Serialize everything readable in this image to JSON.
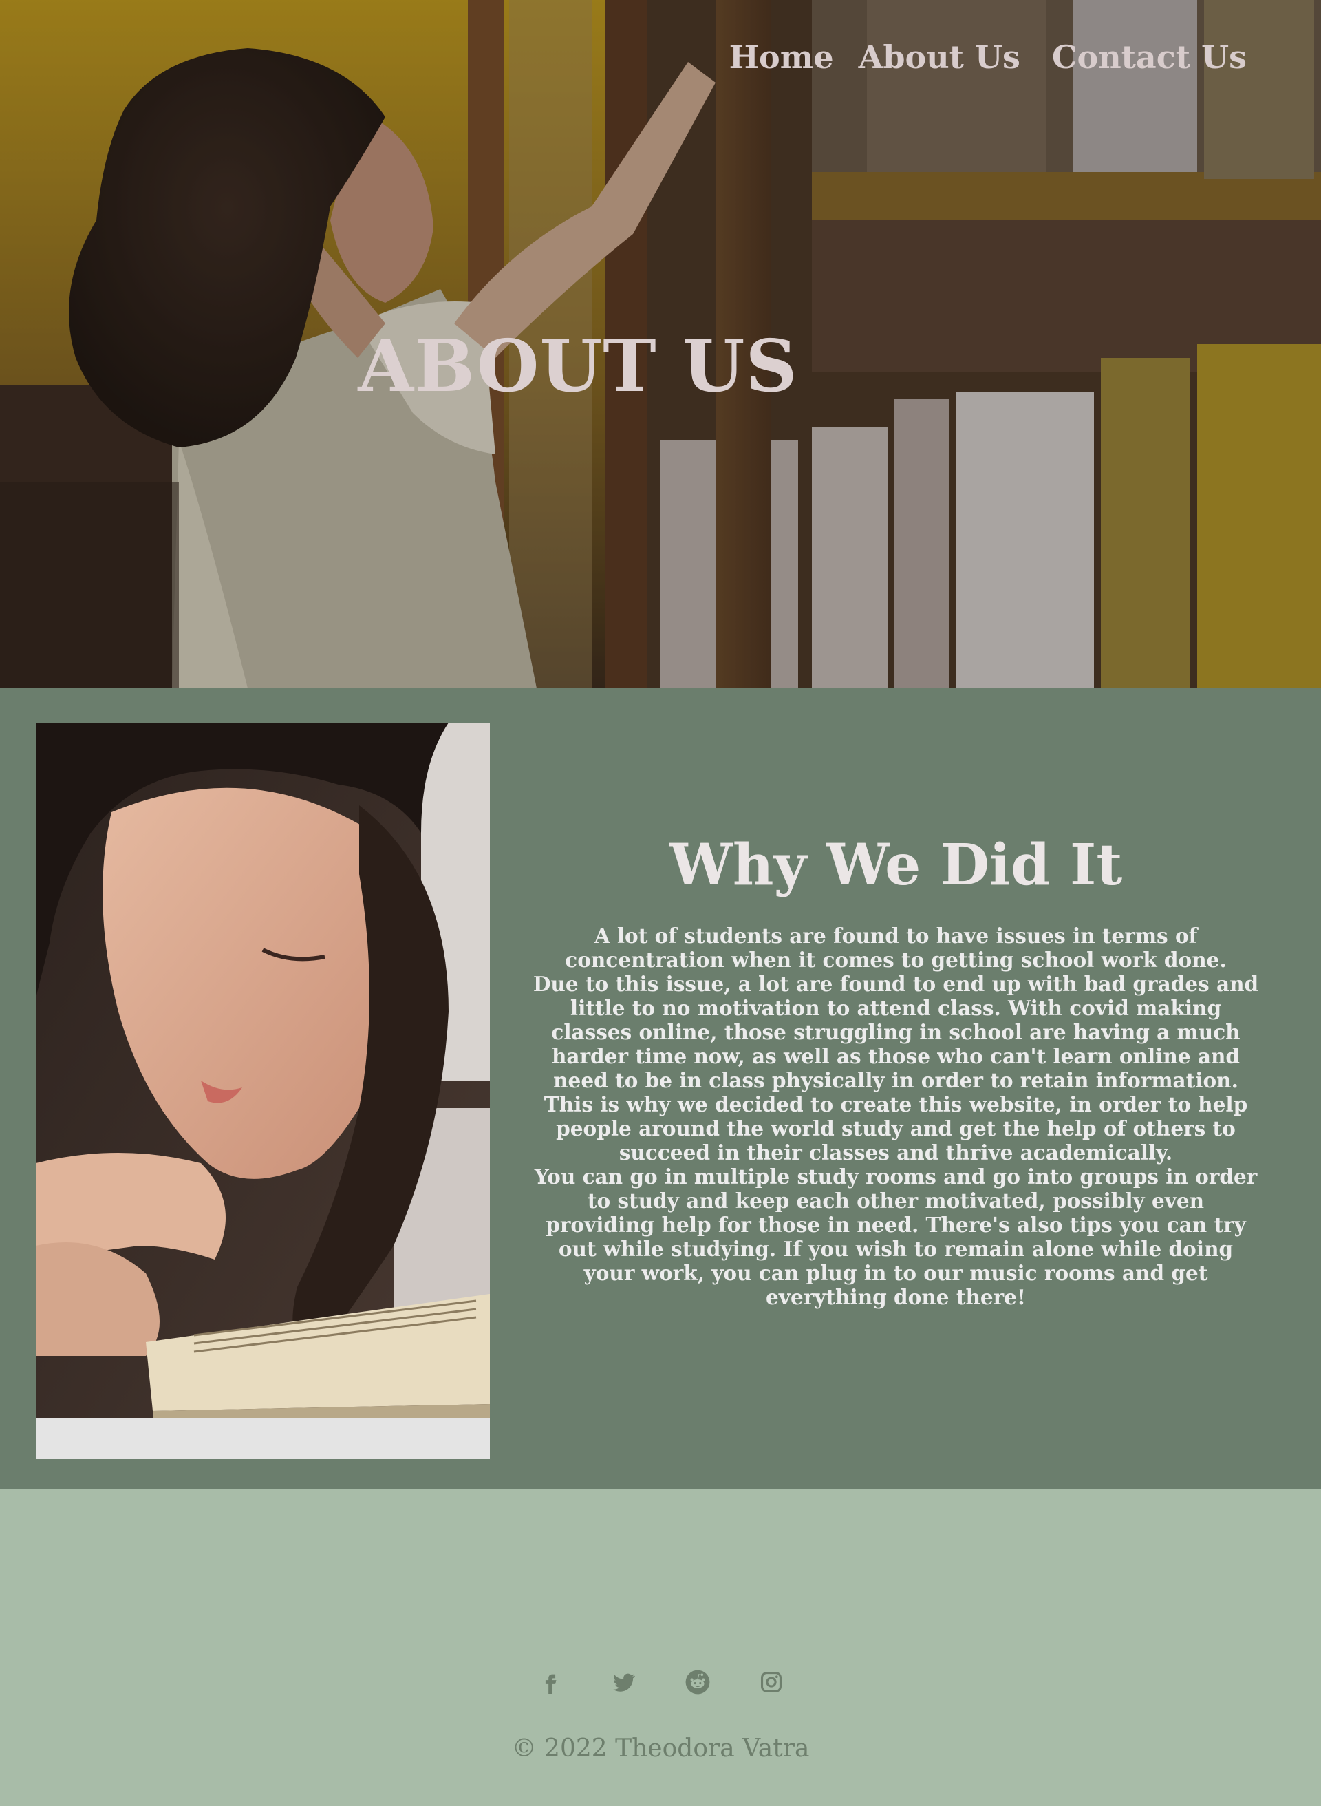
{
  "nav": {
    "home": "Home",
    "about": "About Us",
    "contact": "Contact Us"
  },
  "hero": {
    "title": "ABOUT US"
  },
  "about": {
    "heading": "Why We Did It",
    "paragraphs": [
      "A lot of students are found to have issues in terms of concentration when it comes to getting school work done.",
      "Due to this issue, a lot are found to end up with bad grades and little to no motivation to attend class. With covid making classes online, those struggling in school are having a much harder time now, as well as those who can't learn online and need to be in class physically in order to retain information. This is why we decided to create this website, in order to help people around the world study and get the help of others to succeed in their classes and thrive academically.",
      "You can go in multiple study rooms and go into groups in order to study and keep each other motivated, possibly even providing help for those in need. There's also tips you can try out while studying. If you wish to remain alone while doing your work, you can plug in to our music rooms and get everything done there!"
    ]
  },
  "footer": {
    "social_icons": [
      "facebook-icon",
      "twitter-icon",
      "reddit-icon",
      "instagram-icon"
    ],
    "copyright": "© 2022 Theodora Vatra"
  },
  "colors": {
    "about_bg": "#6b7e6d",
    "footer_bg": "#a8bca8",
    "nav_text": "#d8cccc",
    "icon_color": "#6e7f6d"
  }
}
